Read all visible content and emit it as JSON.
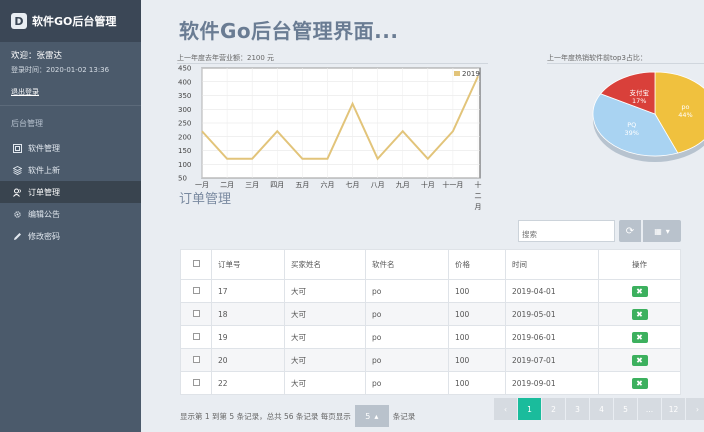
{
  "sidebar": {
    "logo_letter": "D",
    "brand": "软件GO后台管理",
    "welcome": "欢迎：张雷达",
    "login_time": "登录时间：2020-01-02 13:36",
    "logout": "退出登录",
    "menu_header": "后台管理",
    "items": [
      {
        "label": "软件管理",
        "icon": "app-icon"
      },
      {
        "label": "软件上新",
        "icon": "layers-icon"
      },
      {
        "label": "订单管理",
        "icon": "users-icon"
      },
      {
        "label": "编辑公告",
        "icon": "gear-icon"
      },
      {
        "label": "修改密码",
        "icon": "pencil-icon"
      }
    ]
  },
  "main": {
    "title": "软件Go后台管理界面...",
    "line_caption": "上一年度去年营业额：2100 元",
    "pie_caption": "上一年度热销软件前top3占比：",
    "section_title": "订单管理",
    "search_placeholder": "搜索"
  },
  "chart_data": [
    {
      "type": "line",
      "legend": "2019",
      "categories": [
        "一月",
        "二月",
        "三月",
        "四月",
        "五月",
        "六月",
        "七月",
        "八月",
        "九月",
        "十月",
        "十一月",
        "十二月"
      ],
      "series": [
        {
          "name": "2019",
          "values": [
            220,
            120,
            120,
            220,
            120,
            120,
            320,
            120,
            220,
            120,
            220,
            420
          ],
          "color": "#e2c47a"
        }
      ],
      "y_ticks": [
        50,
        100,
        150,
        200,
        250,
        300,
        350,
        400,
        450
      ],
      "ylim": [
        50,
        450
      ]
    },
    {
      "type": "pie",
      "slices": [
        {
          "name": "po",
          "percent": "44%",
          "value": 44,
          "color": "#f0c13e"
        },
        {
          "name": "PQ",
          "percent": "39%",
          "value": 39,
          "color": "#a9d3f2"
        },
        {
          "name": "支付宝",
          "percent": "17%",
          "value": 17,
          "color": "#d9403a"
        }
      ]
    }
  ],
  "table": {
    "headers": [
      "订单号",
      "买家姓名",
      "软件名",
      "价格",
      "时间",
      "操作"
    ],
    "rows": [
      [
        "17",
        "大可",
        "po",
        "100",
        "2019-04-01"
      ],
      [
        "18",
        "大可",
        "po",
        "100",
        "2019-05-01"
      ],
      [
        "19",
        "大可",
        "po",
        "100",
        "2019-06-01"
      ],
      [
        "20",
        "大可",
        "po",
        "100",
        "2019-07-01"
      ],
      [
        "22",
        "大可",
        "po",
        "100",
        "2019-09-01"
      ]
    ],
    "delete_glyph": "✖"
  },
  "footer": {
    "info_before": "显示第 1 到第 5 条记录，总共 56 条记录 每页显示",
    "page_size": "5",
    "info_after": "条记录"
  },
  "pagination": [
    "‹",
    "1",
    "2",
    "3",
    "4",
    "5",
    "...",
    "12",
    "›"
  ],
  "colors": {
    "sidebar": "#4b5a6b",
    "brand_bar": "#3b4756",
    "accent": "#1abc9c",
    "delete": "#3cb05e"
  }
}
